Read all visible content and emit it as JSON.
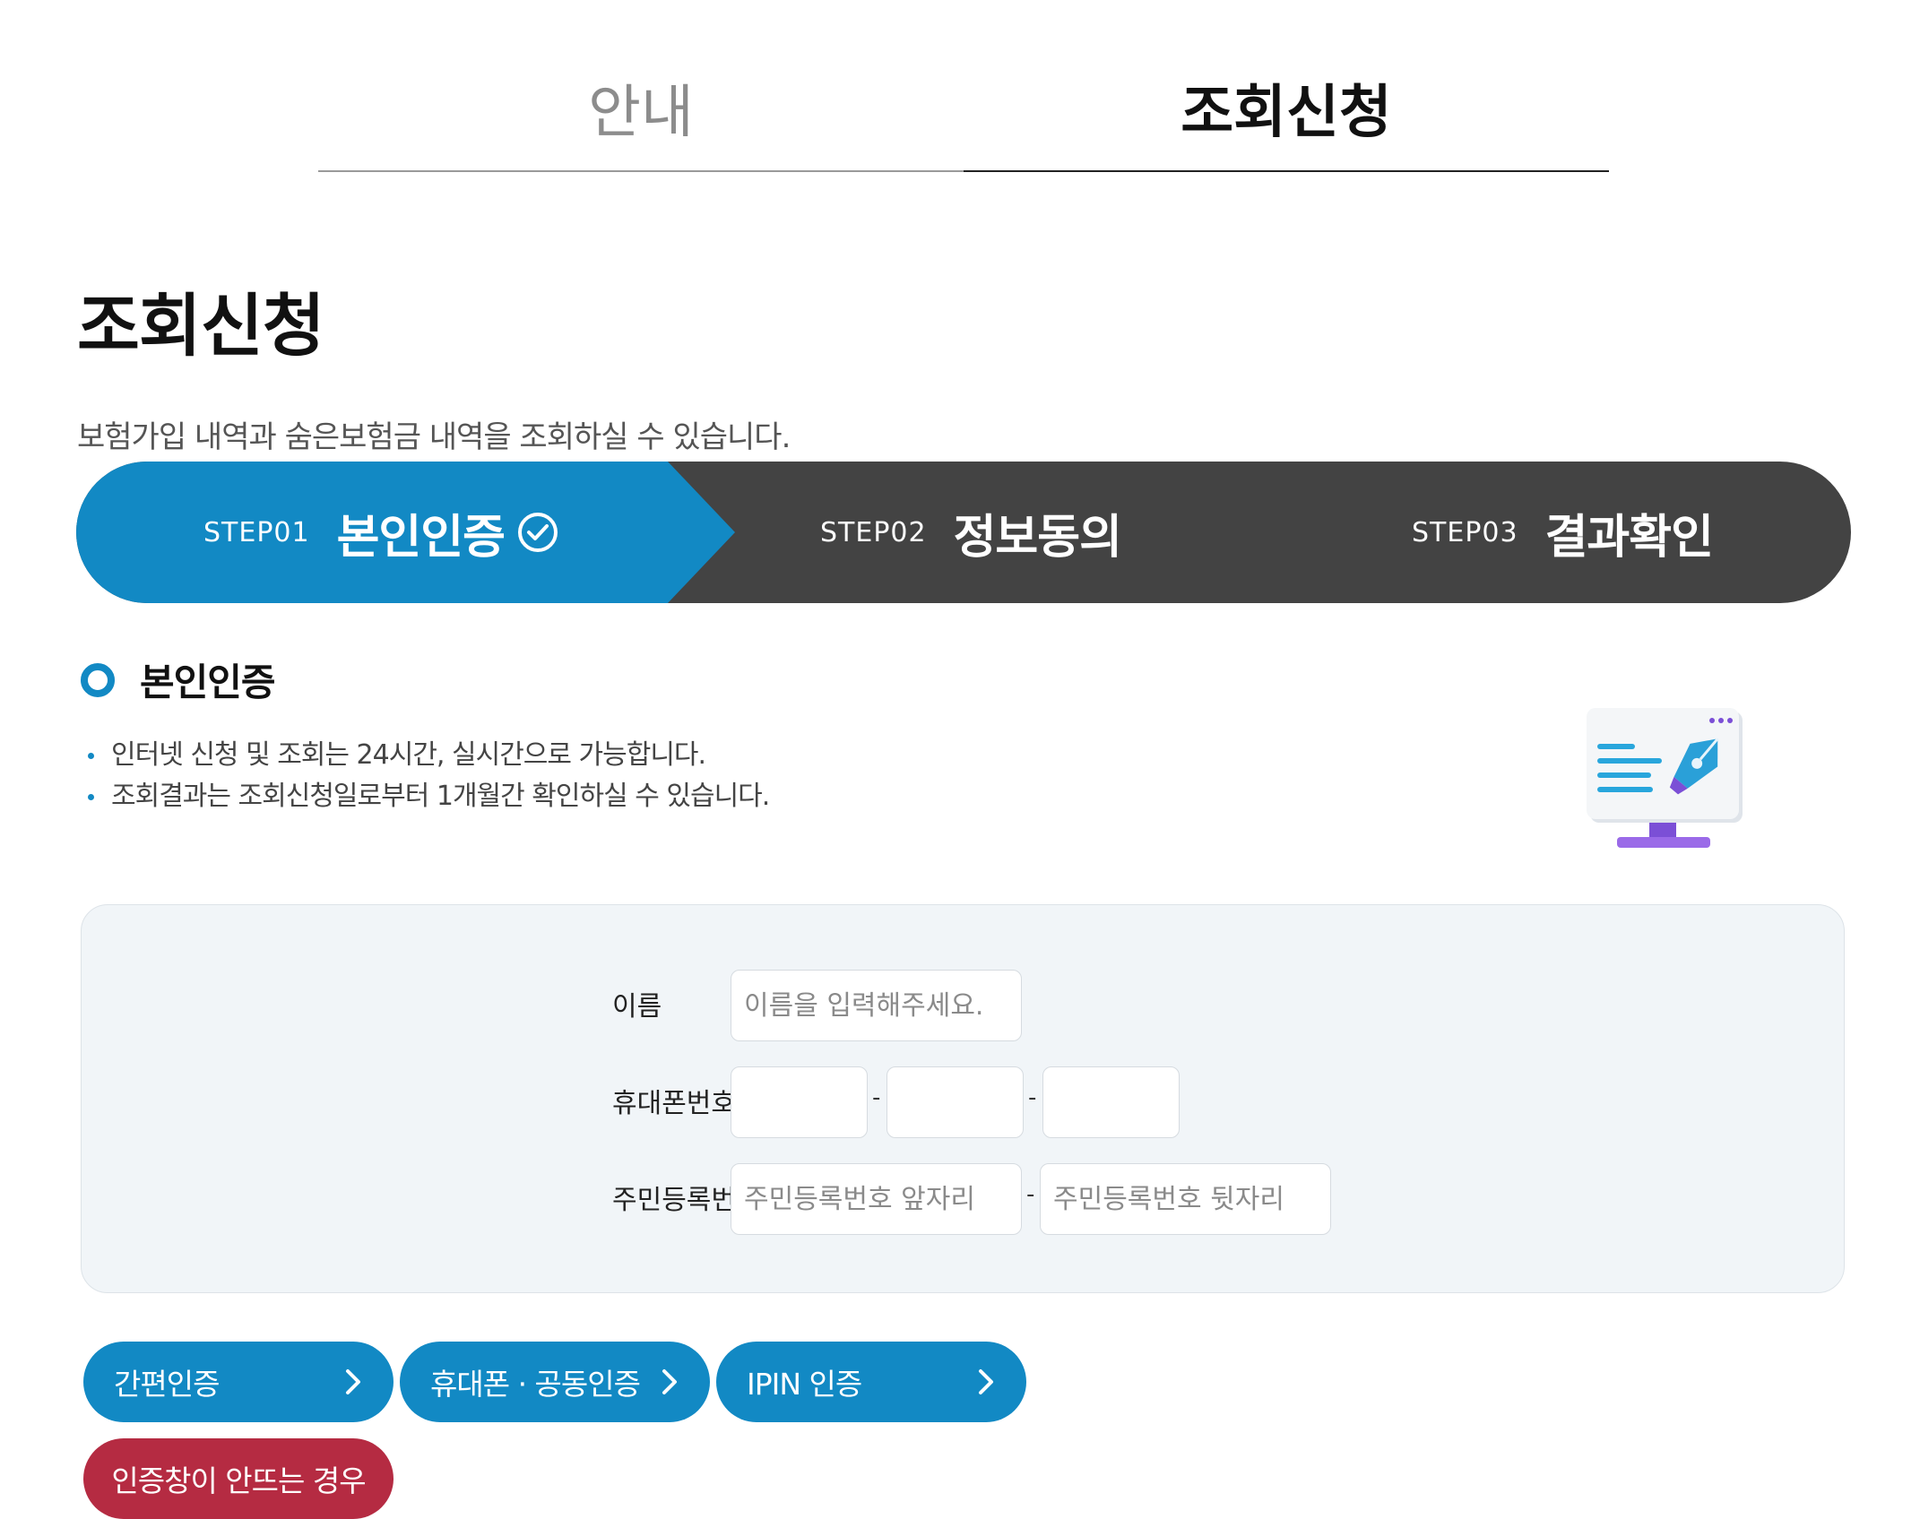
{
  "tabs": [
    {
      "label": "안내",
      "active": false
    },
    {
      "label": "조회신청",
      "active": true
    }
  ],
  "page": {
    "title": "조회신청",
    "subtitle": "보험가입 내역과 숨은보험금 내역을 조회하실 수 있습니다."
  },
  "steps": [
    {
      "num": "STEP01",
      "name": "본인인증",
      "active": true,
      "icon": "check-circle-icon"
    },
    {
      "num": "STEP02",
      "name": "정보동의",
      "active": false
    },
    {
      "num": "STEP03",
      "name": "결과확인",
      "active": false
    }
  ],
  "section": {
    "title": "본인인증",
    "bullets": [
      "인터넷 신청 및 조회는 24시간, 실시간으로 가능합니다.",
      "조회결과는 조회신청일로부터 1개월간 확인하실 수 있습니다."
    ],
    "illustration": "monitor-pen-icon"
  },
  "form": {
    "name_label": "이름",
    "name_placeholder": "이름을 입력해주세요.",
    "phone_label": "휴대폰번호",
    "phone_separator": "-",
    "rrn_label": "주민등록번호",
    "rrn_front_placeholder": "주민등록번호 앞자리",
    "rrn_back_placeholder": "주민등록번호 뒷자리",
    "rrn_separator": "-"
  },
  "buttons": {
    "simple_auth": "간편인증",
    "phone_cert_auth": "휴대폰 · 공동인증",
    "ipin_auth": "IPIN 인증",
    "popup_help": "인증창이 안뜨는 경우"
  },
  "colors": {
    "accent": "#1289c4",
    "step_bg": "#434343",
    "danger": "#b52b42",
    "form_bg": "#f1f5f8"
  }
}
